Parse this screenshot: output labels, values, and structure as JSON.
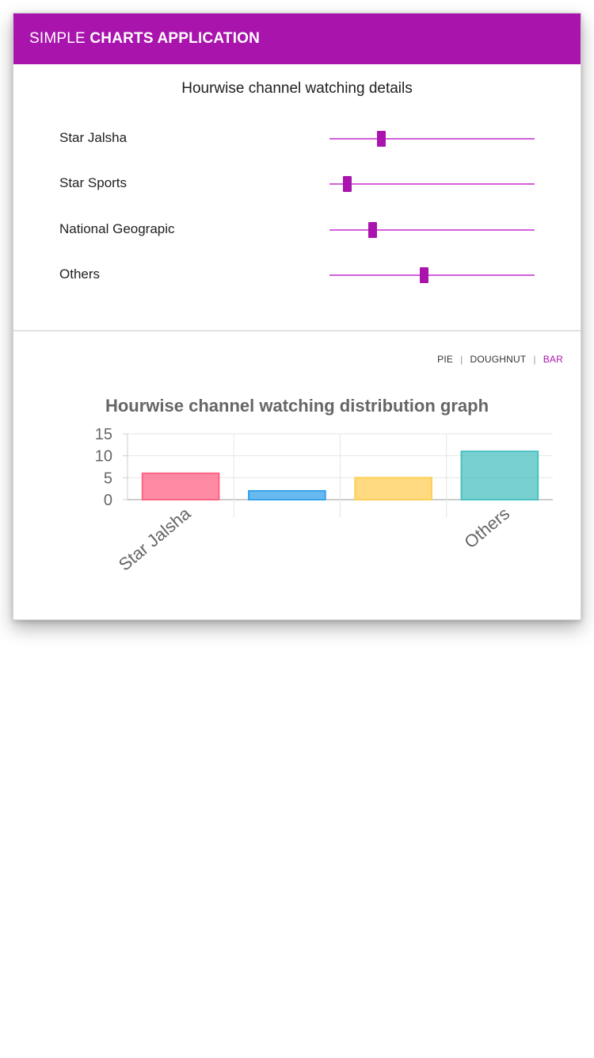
{
  "app": {
    "title_light": "SIMPLE ",
    "title_bold": "CHARTS APPLICATION",
    "accent_color": "#a914ad"
  },
  "details": {
    "title": "Hourwise channel watching details",
    "slider_max": 24,
    "channels": [
      {
        "label": "Star Jalsha",
        "value": 6
      },
      {
        "label": "Star Sports",
        "value": 2
      },
      {
        "label": "National Geograpic",
        "value": 5
      },
      {
        "label": "Others",
        "value": 11
      }
    ]
  },
  "chart_tabs": [
    {
      "label": "PIE",
      "active": false
    },
    {
      "label": "DOUGHNUT",
      "active": false
    },
    {
      "label": "BAR",
      "active": true
    }
  ],
  "chart_data": {
    "type": "bar",
    "title": "Hourwise channel watching distribution graph",
    "categories": [
      "Star Jalsha",
      "Star Sports",
      "National Geograpic",
      "Others"
    ],
    "visible_tick_labels": [
      "Star Jalsha",
      "",
      "",
      "Others"
    ],
    "values": [
      6,
      2,
      5,
      11
    ],
    "colors": [
      "#ff6384",
      "#36a2eb",
      "#ffce56",
      "#4bc0c0"
    ],
    "yticks": [
      0,
      5,
      10,
      15
    ],
    "ylim": [
      0,
      15
    ],
    "grid": true
  }
}
